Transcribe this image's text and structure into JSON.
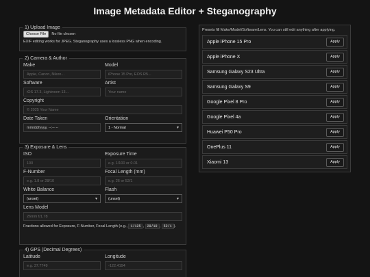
{
  "page": {
    "title": "Image Metadata Editor + Steganography"
  },
  "upload": {
    "legend": "1) Upload Image",
    "choose_button": "Choose File",
    "file_status": "No file chosen",
    "note": "EXIF editing works for JPEG. Steganography uses a lossless PNG when encoding."
  },
  "camera": {
    "legend": "2) Camera & Author",
    "make_label": "Make",
    "make_placeholder": "Apple, Canon, Nikon...",
    "model_label": "Model",
    "model_placeholder": "iPhone 15 Pro, EOS R5...",
    "software_label": "Software",
    "software_placeholder": "iOS 17.3, Lightroom 13...",
    "artist_label": "Artist",
    "artist_placeholder": "Your name",
    "copyright_label": "Copyright",
    "copyright_placeholder": "© 2025 Your Name",
    "date_label": "Date Taken",
    "date_value": "mm/dd/yyyy, --:-- --",
    "orientation_label": "Orientation",
    "orientation_value": "1 - Normal"
  },
  "exposure": {
    "legend": "3) Exposure & Lens",
    "iso_label": "ISO",
    "iso_placeholder": "100",
    "exposure_label": "Exposure Time",
    "exposure_placeholder": "e.g. 1/100 or 0.01",
    "fnumber_label": "F-Number",
    "fnumber_placeholder": "e.g. 1.8 or 28/10",
    "focal_label": "Focal Length (mm)",
    "focal_placeholder": "e.g. 26 or 52/1",
    "wb_label": "White Balance",
    "wb_value": "(unset)",
    "flash_label": "Flash",
    "flash_value": "(unset)",
    "lens_label": "Lens Model",
    "lens_placeholder": "26mm f/1.78",
    "note_prefix": "Fractions allowed for Exposure, F-Number, Focal Length (e.g.,",
    "ex1": "1/125",
    "ex2": "28/10",
    "ex3": "52/1",
    "sep1": ",",
    "sep2": ",",
    "note_suffix": ")."
  },
  "gps": {
    "legend": "4) GPS (Decimal Degrees)",
    "lat_label": "Latitude",
    "lat_placeholder": "e.g. 37.7749",
    "lon_label": "Longitude",
    "lon_placeholder": "-122.4194"
  },
  "presets": {
    "hint": "Presets fill Make/Model/Software/Lens. You can still edit anything after applying.",
    "apply_label": "Apply",
    "items": [
      "Apple iPhone 15 Pro",
      "Apple iPhone X",
      "Samsung Galaxy S23 Ultra",
      "Samsung Galaxy S9",
      "Google Pixel 8 Pro",
      "Google Pixel 4a",
      "Huawei P50 Pro",
      "OnePlus 11",
      "Xiaomi 13"
    ]
  }
}
